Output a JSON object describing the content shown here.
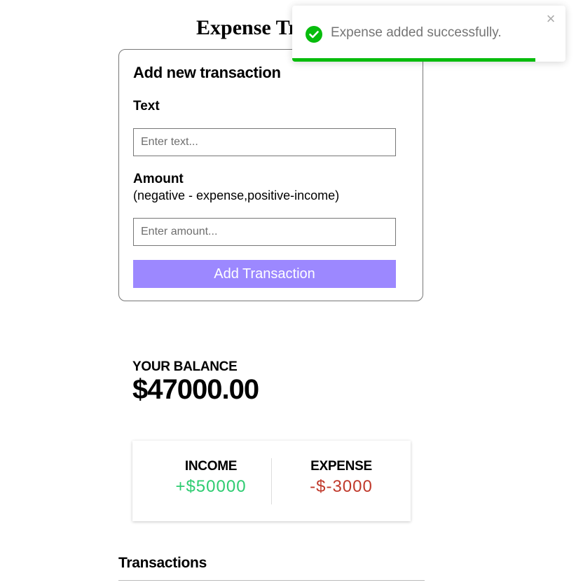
{
  "app": {
    "title": "Expense Tracker"
  },
  "form": {
    "heading": "Add new transaction",
    "text_label": "Text",
    "text_placeholder": "Enter text...",
    "text_value": "",
    "amount_label": "Amount",
    "amount_hint": "(negative - expense,positive-income)",
    "amount_placeholder": "Enter amount...",
    "amount_value": "",
    "submit_label": "Add Transaction",
    "submit_color": "#9c88ff"
  },
  "balance": {
    "title": "YOUR BALANCE",
    "amount": "$47000.00"
  },
  "summary": {
    "income_label": "INCOME",
    "income_value": "+$50000",
    "income_color": "#2ecc71",
    "expense_label": "EXPENSE",
    "expense_value": "-$-3000",
    "expense_color": "#c0392b"
  },
  "transactions": {
    "heading": "Transactions"
  },
  "toast": {
    "message": "Expense added successfully.",
    "icon": "check-circle-icon",
    "close_icon": "close-icon",
    "close_glyph": "×",
    "progress_fraction": 0.89,
    "accent_color": "#07bc0c"
  }
}
